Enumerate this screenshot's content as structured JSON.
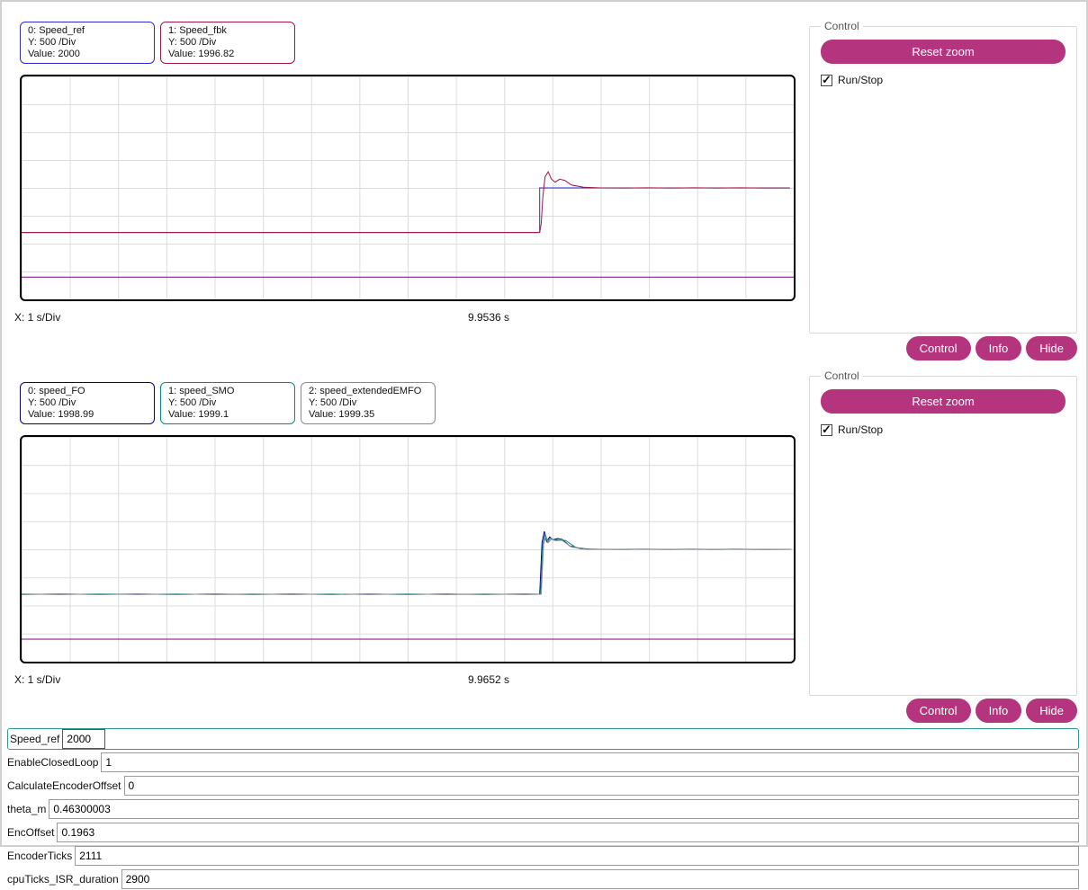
{
  "theme": {
    "accent": "#b5347e",
    "focus_highlight": "#2a9d8f",
    "grid_line": "#dcdcdc",
    "marker_line": "#800080"
  },
  "scopes": [
    {
      "legends": [
        {
          "name": "0: Speed_ref",
          "y_div": "Y: 500 /Div",
          "value": "Value: 2000",
          "color": "#2a2ace"
        },
        {
          "name": "1: Speed_fbk",
          "y_div": "Y: 500 /Div",
          "value": "Value: 1996.82",
          "color": "#a31540"
        }
      ],
      "x_div_label": "X: 1 s/Div",
      "time_label": "9.9536 s",
      "control_group": {
        "title": "Control",
        "reset_button": "Reset zoom",
        "run_checkbox": "Run/Stop",
        "run_checked": true
      },
      "footer_buttons": {
        "control": "Control",
        "info": "Info",
        "hide": "Hide"
      }
    },
    {
      "legends": [
        {
          "name": "0: speed_FO",
          "y_div": "Y: 500 /Div",
          "value": "Value: 1998.99",
          "color": "#000088"
        },
        {
          "name": "1: speed_SMO",
          "y_div": "Y: 500 /Div",
          "value": "Value: 1999.1",
          "color": "#008b8b"
        },
        {
          "name": "2: speed_extendedEMFO",
          "y_div": "Y: 500 /Div",
          "value": "Value: 1999.35",
          "color": "#8a8a8a"
        }
      ],
      "x_div_label": "X: 1 s/Div",
      "time_label": "9.9652 s",
      "control_group": {
        "title": "Control",
        "reset_button": "Reset zoom",
        "run_checkbox": "Run/Stop",
        "run_checked": true
      },
      "footer_buttons": {
        "control": "Control",
        "info": "Info",
        "hide": "Hide"
      }
    }
  ],
  "params": [
    {
      "label": "Speed_ref",
      "value": "2000",
      "focused": true
    },
    {
      "label": "EnableClosedLoop",
      "value": "1",
      "focused": false
    },
    {
      "label": "CalculateEncoderOffset",
      "value": "0",
      "focused": false
    },
    {
      "label": "theta_m",
      "value": "0.46300003",
      "focused": false
    },
    {
      "label": "EncOffset",
      "value": "0.1963",
      "focused": false
    },
    {
      "label": "EncoderTicks",
      "value": "2111",
      "focused": false
    },
    {
      "label": "cpuTicks_ISR_duration",
      "value": "2900",
      "focused": false
    }
  ],
  "chart_data": [
    {
      "type": "line",
      "title": "",
      "x_per_div": "1 s/Div",
      "y_per_div": 500,
      "current_time_s": 9.9536,
      "xlim": [
        0,
        10
      ],
      "ylim": [
        -3000,
        7000
      ],
      "grid": true,
      "series": [
        {
          "name": "Speed_ref",
          "color": "#2a2ace",
          "points": [
            [
              0,
              0
            ],
            [
              6.71,
              0
            ],
            [
              6.71,
              2000
            ],
            [
              9.95,
              2000
            ]
          ]
        },
        {
          "name": "Speed_fbk",
          "color": "#a31540",
          "points": [
            [
              0,
              0
            ],
            [
              6.71,
              0
            ],
            [
              6.73,
              400
            ],
            [
              6.75,
              1600
            ],
            [
              6.78,
              2500
            ],
            [
              6.82,
              2720
            ],
            [
              6.86,
              2400
            ],
            [
              6.91,
              2260
            ],
            [
              6.97,
              2390
            ],
            [
              7.04,
              2330
            ],
            [
              7.12,
              2130
            ],
            [
              7.28,
              2030
            ],
            [
              7.5,
              2000
            ],
            [
              7.8,
              1995
            ],
            [
              8.1,
              2004
            ],
            [
              8.4,
              1995
            ],
            [
              8.7,
              2003
            ],
            [
              9.0,
              1996
            ],
            [
              9.3,
              2003
            ],
            [
              9.6,
              1995
            ],
            [
              9.95,
              1997
            ]
          ]
        },
        {
          "name": "marker",
          "color": "#800080",
          "points": [
            [
              0,
              -2000
            ],
            [
              10,
              -2000
            ]
          ]
        }
      ]
    },
    {
      "type": "line",
      "title": "",
      "x_per_div": "1 s/Div",
      "y_per_div": 500,
      "current_time_s": 9.9652,
      "xlim": [
        0,
        10
      ],
      "ylim": [
        -3000,
        7000
      ],
      "grid": true,
      "series": [
        {
          "name": "speed_FO",
          "color": "#000088",
          "points": [
            [
              0,
              -12
            ],
            [
              0.5,
              10
            ],
            [
              1,
              -8
            ],
            [
              1.5,
              14
            ],
            [
              2,
              -10
            ],
            [
              2.5,
              8
            ],
            [
              3,
              -14
            ],
            [
              3.5,
              12
            ],
            [
              4,
              -6
            ],
            [
              4.5,
              10
            ],
            [
              5,
              -12
            ],
            [
              5.5,
              8
            ],
            [
              6,
              -10
            ],
            [
              6.5,
              12
            ],
            [
              6.71,
              0
            ],
            [
              6.74,
              2300
            ],
            [
              6.77,
              2800
            ],
            [
              6.8,
              2350
            ],
            [
              6.84,
              2550
            ],
            [
              6.88,
              2420
            ],
            [
              6.94,
              2480
            ],
            [
              7.0,
              2440
            ],
            [
              7.1,
              2150
            ],
            [
              7.25,
              2020
            ],
            [
              7.45,
              2000
            ],
            [
              7.8,
              1996
            ],
            [
              8.1,
              2004
            ],
            [
              8.4,
              1995
            ],
            [
              8.7,
              2003
            ],
            [
              9.0,
              1996
            ],
            [
              9.3,
              2004
            ],
            [
              9.6,
              1995
            ],
            [
              9.97,
              1999
            ]
          ]
        },
        {
          "name": "speed_SMO",
          "color": "#008b8b",
          "points": [
            [
              0,
              8
            ],
            [
              0.5,
              -10
            ],
            [
              1,
              12
            ],
            [
              1.5,
              -8
            ],
            [
              2,
              10
            ],
            [
              2.5,
              -12
            ],
            [
              3,
              6
            ],
            [
              3.5,
              -14
            ],
            [
              4,
              10
            ],
            [
              4.5,
              -8
            ],
            [
              5,
              12
            ],
            [
              5.5,
              -6
            ],
            [
              6,
              8
            ],
            [
              6.5,
              -12
            ],
            [
              6.72,
              0
            ],
            [
              6.75,
              2250
            ],
            [
              6.78,
              2700
            ],
            [
              6.81,
              2320
            ],
            [
              6.85,
              2500
            ],
            [
              6.9,
              2400
            ],
            [
              6.96,
              2450
            ],
            [
              7.05,
              2380
            ],
            [
              7.18,
              2080
            ],
            [
              7.35,
              2005
            ],
            [
              7.7,
              1999
            ],
            [
              8.0,
              2005
            ],
            [
              8.3,
              1995
            ],
            [
              8.6,
              2004
            ],
            [
              8.9,
              1996
            ],
            [
              9.2,
              2003
            ],
            [
              9.5,
              1996
            ],
            [
              9.97,
              1999
            ]
          ]
        },
        {
          "name": "speed_extendedEMFO",
          "color": "#8a8a8a",
          "points": [
            [
              0,
              -5
            ],
            [
              0.5,
              6
            ],
            [
              1,
              -7
            ],
            [
              1.5,
              5
            ],
            [
              2,
              -6
            ],
            [
              2.5,
              7
            ],
            [
              3,
              -5
            ],
            [
              3.5,
              6
            ],
            [
              4,
              -7
            ],
            [
              4.5,
              5
            ],
            [
              5,
              -6
            ],
            [
              5.5,
              7
            ],
            [
              6,
              -5
            ],
            [
              6.5,
              6
            ],
            [
              6.73,
              0
            ],
            [
              6.76,
              2200
            ],
            [
              6.79,
              2600
            ],
            [
              6.82,
              2300
            ],
            [
              6.86,
              2450
            ],
            [
              6.92,
              2380
            ],
            [
              7.0,
              2400
            ],
            [
              7.12,
              2100
            ],
            [
              7.3,
              2010
            ],
            [
              7.6,
              2000
            ],
            [
              9.97,
              1999
            ]
          ]
        },
        {
          "name": "marker",
          "color": "#800080",
          "points": [
            [
              0,
              -2000
            ],
            [
              10,
              -2000
            ]
          ]
        }
      ]
    }
  ]
}
